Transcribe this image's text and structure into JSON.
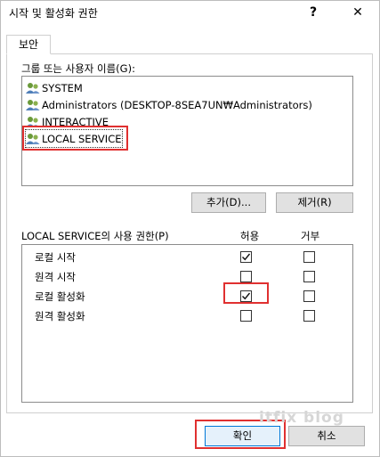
{
  "window": {
    "title": "시작 및 활성화 권한",
    "help_glyph": "?",
    "close_glyph": "✕"
  },
  "tabs": [
    {
      "label": "보안",
      "active": true
    }
  ],
  "users_section": {
    "label": "그룹 또는 사용자 이름(G):",
    "users": [
      {
        "name": "SYSTEM",
        "icon": "user-group-icon"
      },
      {
        "name": "Administrators (DESKTOP-8SEA7UN₩Administrators)",
        "icon": "user-group-icon"
      },
      {
        "name": "INTERACTIVE",
        "icon": "user-group-icon"
      },
      {
        "name": "LOCAL SERVICE",
        "icon": "user-group-icon",
        "selected": true
      }
    ],
    "add_button": "추가(D)...",
    "remove_button": "제거(R)"
  },
  "permissions_section": {
    "label": "LOCAL SERVICE의 사용 권한(P)",
    "allow_header": "허용",
    "deny_header": "거부",
    "permissions": [
      {
        "name": "로컬 시작",
        "allow": true,
        "deny": false
      },
      {
        "name": "원격 시작",
        "allow": false,
        "deny": false
      },
      {
        "name": "로컬 활성화",
        "allow": true,
        "deny": false
      },
      {
        "name": "원격 활성화",
        "allow": false,
        "deny": false
      }
    ]
  },
  "footer": {
    "ok_button": "확인",
    "cancel_button": "취소"
  },
  "watermark": "itfix blog",
  "colors": {
    "highlight": "#e03030",
    "ok_border": "#0078d7",
    "button_bg": "#e1e1e1"
  }
}
